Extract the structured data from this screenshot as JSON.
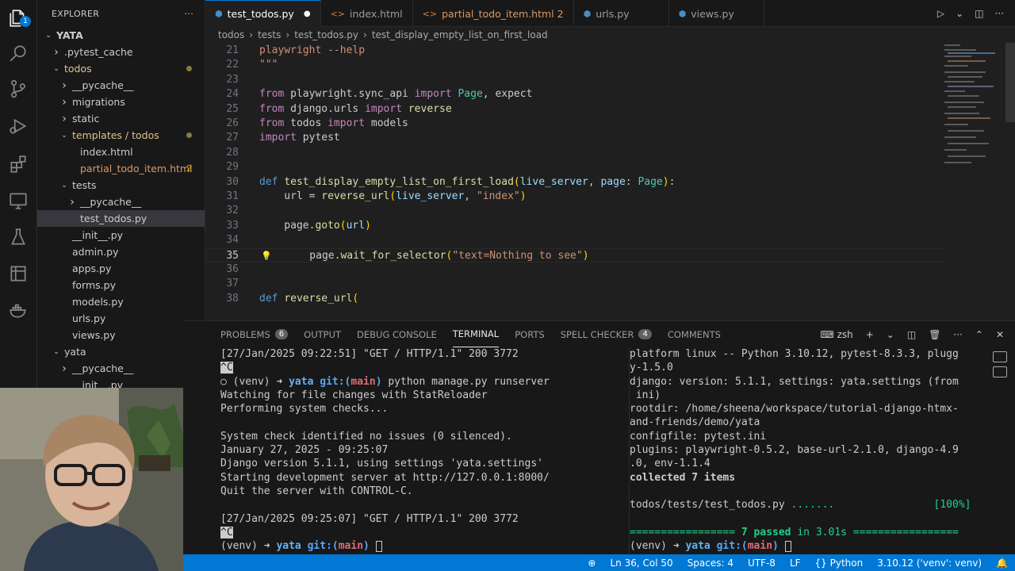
{
  "activity": {
    "explorer_badge": "1"
  },
  "sidebar": {
    "title": "EXPLORER",
    "more": "···",
    "items": [
      {
        "label": "YATA",
        "indent": 0,
        "chevron": "v",
        "bold": true
      },
      {
        "label": ".pytest_cache",
        "indent": 1,
        "chevron": ">"
      },
      {
        "label": "todos",
        "indent": 1,
        "chevron": "v",
        "mod": true,
        "dot": true
      },
      {
        "label": "__pycache__",
        "indent": 2,
        "chevron": ">"
      },
      {
        "label": "migrations",
        "indent": 2,
        "chevron": ">"
      },
      {
        "label": "static",
        "indent": 2,
        "chevron": ">"
      },
      {
        "label": "templates / todos",
        "indent": 2,
        "chevron": "v",
        "mod": true,
        "dot": true
      },
      {
        "label": "index.html",
        "indent": 3,
        "chevron": ""
      },
      {
        "label": "partial_todo_item.html",
        "indent": 3,
        "chevron": "",
        "warn": true,
        "num": "2"
      },
      {
        "label": "tests",
        "indent": 2,
        "chevron": "v"
      },
      {
        "label": "__pycache__",
        "indent": 3,
        "chevron": ">"
      },
      {
        "label": "test_todos.py",
        "indent": 3,
        "chevron": "",
        "selected": true
      },
      {
        "label": "__init__.py",
        "indent": 2,
        "chevron": ""
      },
      {
        "label": "admin.py",
        "indent": 2,
        "chevron": ""
      },
      {
        "label": "apps.py",
        "indent": 2,
        "chevron": ""
      },
      {
        "label": "forms.py",
        "indent": 2,
        "chevron": ""
      },
      {
        "label": "models.py",
        "indent": 2,
        "chevron": ""
      },
      {
        "label": "urls.py",
        "indent": 2,
        "chevron": ""
      },
      {
        "label": "views.py",
        "indent": 2,
        "chevron": ""
      },
      {
        "label": "yata",
        "indent": 1,
        "chevron": "v"
      },
      {
        "label": "__pycache__",
        "indent": 2,
        "chevron": ">"
      },
      {
        "label": "__init__.py",
        "indent": 2,
        "chevron": ""
      }
    ]
  },
  "tabs": [
    {
      "label": "test_todos.py",
      "icon": "python",
      "active": true,
      "close": "●"
    },
    {
      "label": "index.html",
      "icon": "html"
    },
    {
      "label": "partial_todo_item.html",
      "icon": "html",
      "warn": true,
      "num": "2"
    },
    {
      "label": "urls.py",
      "icon": "python"
    },
    {
      "label": "views.py",
      "icon": "python"
    }
  ],
  "breadcrumb": [
    "todos",
    "tests",
    "test_todos.py",
    "test_display_empty_list_on_first_load"
  ],
  "code": [
    {
      "n": "21",
      "segs": [
        [
          "playwright --help",
          "str"
        ]
      ]
    },
    {
      "n": "22",
      "segs": [
        [
          "\"\"\"",
          "str"
        ]
      ]
    },
    {
      "n": "23",
      "segs": []
    },
    {
      "n": "24",
      "segs": [
        [
          "from",
          "kw"
        ],
        [
          " playwright.sync_api ",
          ""
        ],
        [
          "import",
          "kw"
        ],
        [
          " ",
          ""
        ],
        [
          "Page",
          "cls"
        ],
        [
          ", expect",
          ""
        ]
      ]
    },
    {
      "n": "25",
      "segs": [
        [
          "from",
          "kw"
        ],
        [
          " django.urls ",
          ""
        ],
        [
          "import",
          "kw"
        ],
        [
          " ",
          ""
        ],
        [
          "reverse",
          "fn"
        ]
      ]
    },
    {
      "n": "26",
      "segs": [
        [
          "from",
          "kw"
        ],
        [
          " todos ",
          ""
        ],
        [
          "import",
          "kw"
        ],
        [
          " models",
          ""
        ]
      ]
    },
    {
      "n": "27",
      "segs": [
        [
          "import",
          "kw"
        ],
        [
          " pytest",
          ""
        ]
      ]
    },
    {
      "n": "28",
      "segs": []
    },
    {
      "n": "29",
      "segs": []
    },
    {
      "n": "30",
      "segs": [
        [
          "def",
          "kd"
        ],
        [
          " ",
          ""
        ],
        [
          "test_display_empty_list_on_first_load",
          "fn"
        ],
        [
          "(",
          "par"
        ],
        [
          "live_server",
          "vr"
        ],
        [
          ", ",
          ""
        ],
        [
          "page",
          "vr"
        ],
        [
          ": ",
          ""
        ],
        [
          "Page",
          "cls"
        ],
        [
          ")",
          "par"
        ],
        [
          ":",
          ""
        ]
      ]
    },
    {
      "n": "31",
      "segs": [
        [
          "    url = ",
          ""
        ],
        [
          "reverse_url",
          "fn"
        ],
        [
          "(",
          "par"
        ],
        [
          "live_server",
          "vr"
        ],
        [
          ", ",
          ""
        ],
        [
          "\"index\"",
          "str"
        ],
        [
          ")",
          "par"
        ]
      ]
    },
    {
      "n": "32",
      "segs": []
    },
    {
      "n": "33",
      "segs": [
        [
          "    page.",
          ""
        ],
        [
          "goto",
          "fn"
        ],
        [
          "(",
          "par"
        ],
        [
          "url",
          "vr"
        ],
        [
          ")",
          "par"
        ]
      ]
    },
    {
      "n": "34",
      "segs": []
    },
    {
      "n": "35",
      "segs": [
        [
          "    page.",
          ""
        ],
        [
          "wait_for_selector",
          "fn"
        ],
        [
          "(",
          "par"
        ],
        [
          "\"text=Nothing to see\"",
          "str"
        ],
        [
          ")",
          "par"
        ]
      ],
      "current": true
    },
    {
      "n": "36",
      "segs": []
    },
    {
      "n": "37",
      "segs": []
    },
    {
      "n": "38",
      "segs": [
        [
          "def",
          "kd"
        ],
        [
          " ",
          ""
        ],
        [
          "reverse_url",
          "fn"
        ],
        [
          "(",
          "par"
        ]
      ]
    }
  ],
  "panel": {
    "tabs": [
      {
        "label": "PROBLEMS",
        "badge": "6"
      },
      {
        "label": "OUTPUT"
      },
      {
        "label": "DEBUG CONSOLE"
      },
      {
        "label": "TERMINAL",
        "active": true
      },
      {
        "label": "PORTS"
      },
      {
        "label": "SPELL CHECKER",
        "badge": "4"
      },
      {
        "label": "COMMENTS"
      }
    ],
    "shell": "zsh",
    "plus": "+",
    "down": "⌄",
    "more": "···",
    "up": "⌃",
    "close": "✕"
  },
  "term_left": [
    [
      [
        "[27/Jan/2025 09:22:51] \"GET / HTTP/1.1\" 200 3772",
        ""
      ]
    ],
    [
      [
        "^C",
        "ctrlc"
      ]
    ],
    [
      [
        "○ ",
        ""
      ],
      [
        "(venv) ",
        ""
      ],
      [
        "➜ ",
        "arrow"
      ],
      [
        "yata ",
        "dir"
      ],
      [
        "git:(",
        "git"
      ],
      [
        "main",
        "br"
      ],
      [
        ")",
        "git"
      ],
      [
        " python manage.py runserver",
        ""
      ]
    ],
    [
      [
        "Watching for file changes with StatReloader",
        ""
      ]
    ],
    [
      [
        "Performing system checks...",
        ""
      ]
    ],
    [
      [
        "",
        ""
      ]
    ],
    [
      [
        "System check identified no issues (0 silenced).",
        ""
      ]
    ],
    [
      [
        "January 27, 2025 - 09:25:07",
        ""
      ]
    ],
    [
      [
        "Django version 5.1.1, using settings 'yata.settings'",
        ""
      ]
    ],
    [
      [
        "Starting development server at http://127.0.0.1:8000/",
        ""
      ]
    ],
    [
      [
        "Quit the server with CONTROL-C.",
        ""
      ]
    ],
    [
      [
        "",
        ""
      ]
    ],
    [
      [
        "[27/Jan/2025 09:25:07] \"GET / HTTP/1.1\" 200 3772",
        ""
      ]
    ],
    [
      [
        "^C",
        "ctrlc"
      ]
    ],
    [
      [
        "(venv) ",
        ""
      ],
      [
        "➜ ",
        "arrow"
      ],
      [
        "yata ",
        "dir"
      ],
      [
        "git:(",
        "git"
      ],
      [
        "main",
        "br"
      ],
      [
        ")",
        "git"
      ],
      [
        " ",
        ""
      ],
      [
        "CURSOR",
        "cursor"
      ]
    ]
  ],
  "term_right": [
    [
      [
        "platform linux -- Python 3.10.12, pytest-8.3.3, plugg",
        ""
      ]
    ],
    [
      [
        "y-1.5.0",
        ""
      ]
    ],
    [
      [
        "django: version: 5.1.1, settings: yata.settings (from",
        ""
      ]
    ],
    [
      [
        " ini)",
        ""
      ]
    ],
    [
      [
        "rootdir: /home/sheena/workspace/tutorial-django-htmx-",
        ""
      ]
    ],
    [
      [
        "and-friends/demo/yata",
        ""
      ]
    ],
    [
      [
        "configfile: pytest.ini",
        ""
      ]
    ],
    [
      [
        "plugins: playwright-0.5.2, base-url-2.1.0, django-4.9",
        ""
      ]
    ],
    [
      [
        ".0, env-1.1.4",
        ""
      ]
    ],
    [
      [
        "collected 7 items",
        "bold"
      ]
    ],
    [
      [
        "",
        ""
      ]
    ],
    [
      [
        "todos/tests/test_todos.py ",
        ""
      ],
      [
        ".......",
        "grn"
      ],
      [
        "                [100%]",
        "grn"
      ]
    ],
    [
      [
        "",
        ""
      ]
    ],
    [
      [
        "================= ",
        "grn"
      ],
      [
        "7 passed",
        "gbold"
      ],
      [
        " in 3.01s",
        "grn"
      ],
      [
        " =================",
        "grn"
      ]
    ],
    [
      [
        "(venv) ",
        ""
      ],
      [
        "➜ ",
        "arrow"
      ],
      [
        "yata ",
        "dir"
      ],
      [
        "git:(",
        "git"
      ],
      [
        "main",
        "br"
      ],
      [
        ")",
        "git"
      ],
      [
        " ",
        ""
      ],
      [
        "CURSOR",
        "cursor"
      ]
    ]
  ],
  "status": {
    "zoom_icon": "⊕",
    "position": "Ln 36, Col 50",
    "spaces": "Spaces: 4",
    "encoding": "UTF-8",
    "eol": "LF",
    "language": "{} Python",
    "interpreter": "3.10.12 ('venv': venv)"
  }
}
